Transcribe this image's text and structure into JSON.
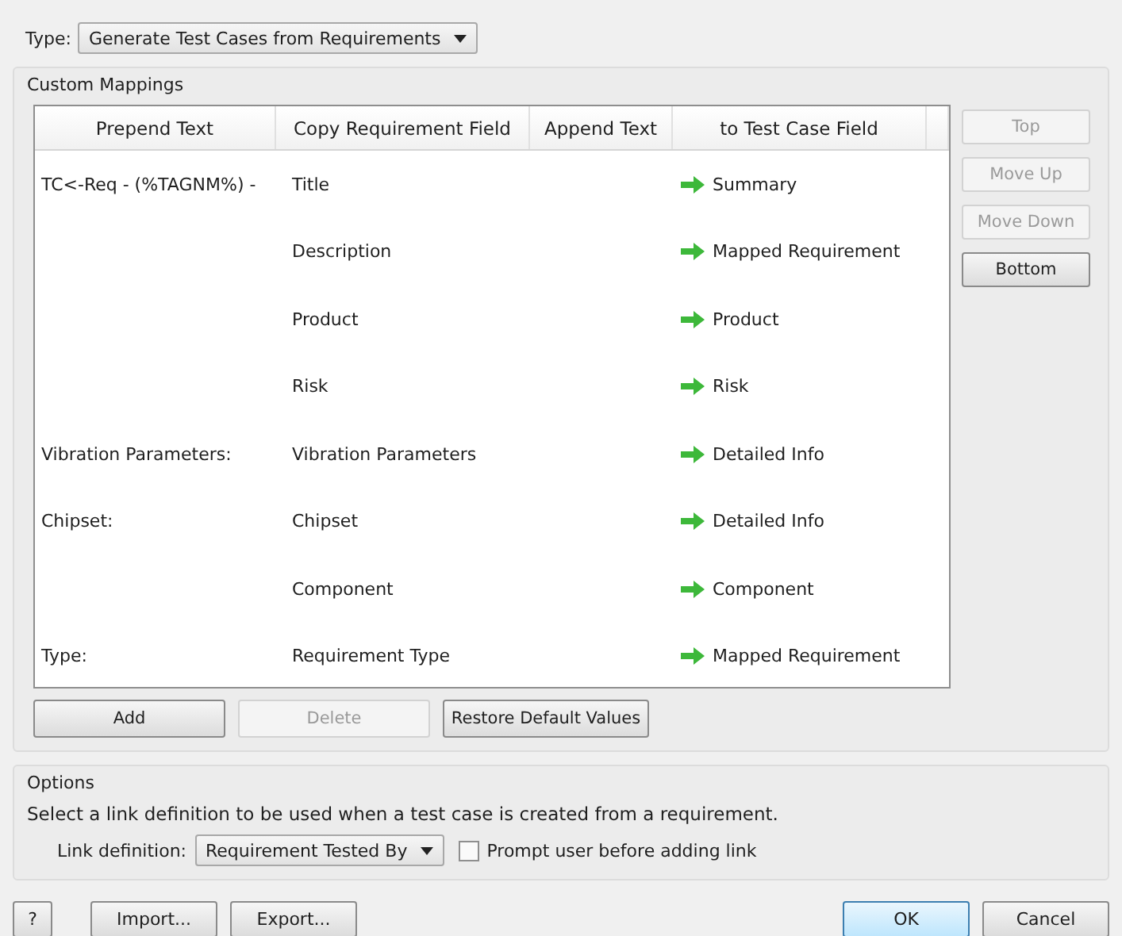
{
  "type_field": {
    "label": "Type:",
    "value": "Generate Test Cases from Requirements"
  },
  "custom_mappings": {
    "title": "Custom Mappings",
    "columns": [
      "Prepend Text",
      "Copy Requirement Field",
      "Append Text",
      "to Test Case Field"
    ],
    "rows": [
      {
        "prepend": "TC<-Req - (%TAGNM%) -",
        "field": "Title",
        "append": "",
        "target": "Summary"
      },
      {
        "prepend": "",
        "field": "Description",
        "append": "",
        "target": "Mapped Requirement"
      },
      {
        "prepend": "",
        "field": "Product",
        "append": "",
        "target": "Product"
      },
      {
        "prepend": "",
        "field": "Risk",
        "append": "",
        "target": "Risk"
      },
      {
        "prepend": "Vibration Parameters:",
        "field": "Vibration Parameters",
        "append": "",
        "target": "Detailed Info"
      },
      {
        "prepend": "Chipset:",
        "field": "Chipset",
        "append": "",
        "target": "Detailed Info"
      },
      {
        "prepend": "",
        "field": "Component",
        "append": "",
        "target": "Component"
      },
      {
        "prepend": "Type:",
        "field": "Requirement Type",
        "append": "",
        "target": "Mapped Requirement"
      }
    ],
    "side_buttons": [
      {
        "label": "Top",
        "disabled": true
      },
      {
        "label": "Move Up",
        "disabled": true
      },
      {
        "label": "Move Down",
        "disabled": true
      },
      {
        "label": "Bottom",
        "disabled": false
      }
    ],
    "buttons": [
      {
        "label": "Add",
        "disabled": false
      },
      {
        "label": "Delete",
        "disabled": true
      },
      {
        "label": "Restore Default Values",
        "disabled": false
      }
    ]
  },
  "options": {
    "title": "Options",
    "description": "Select a link definition to be used when a test case is created from a requirement.",
    "link_label": "Link definition:",
    "link_value": "Requirement Tested By",
    "prompt": {
      "label": "Prompt user before adding link",
      "checked": false
    }
  },
  "footer": {
    "help": "?",
    "import": "Import...",
    "export": "Export...",
    "ok": "OK",
    "cancel": "Cancel"
  }
}
